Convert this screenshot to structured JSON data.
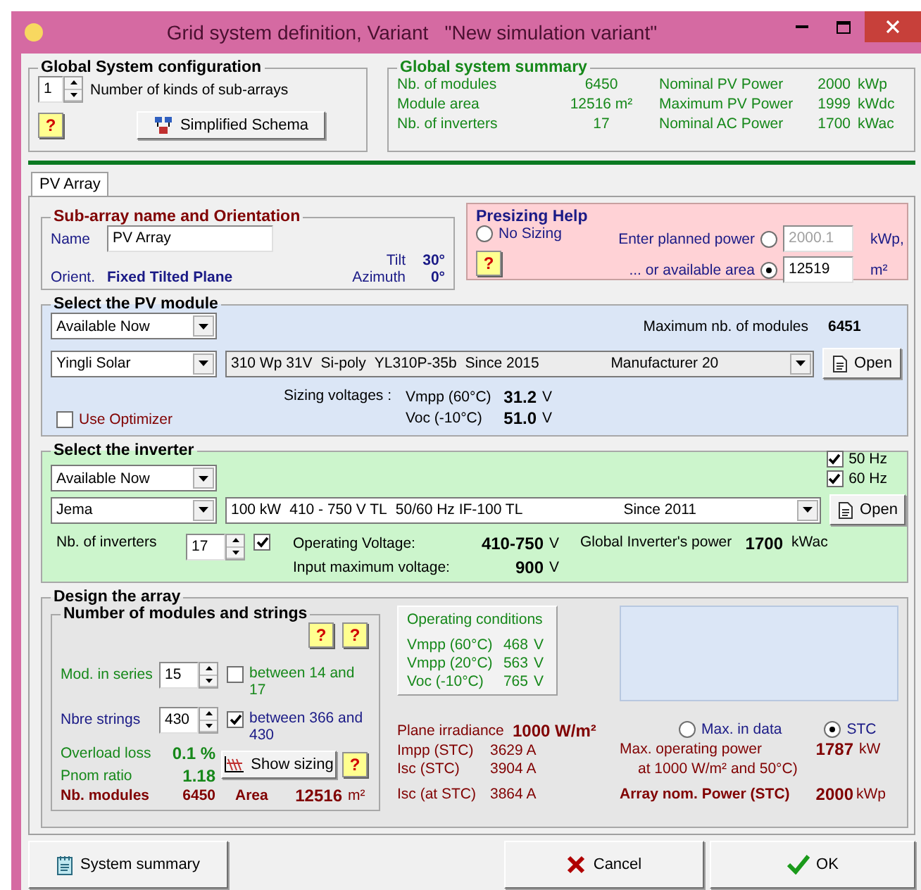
{
  "window": {
    "title": "Grid system definition, Variant   \"New simulation variant\""
  },
  "global_config": {
    "title": "Global System configuration",
    "count": "1",
    "count_label": "Number of kinds of sub-arrays",
    "help": "?",
    "schema_button": "Simplified Schema"
  },
  "summary": {
    "title": "Global system summary",
    "left": [
      {
        "label": "Nb. of modules",
        "value": "6450"
      },
      {
        "label": "Module area",
        "value": "12516 m²"
      },
      {
        "label": "Nb. of inverters",
        "value": "17"
      }
    ],
    "right": [
      {
        "label": "Nominal PV Power",
        "value": "2000",
        "unit": "kWp"
      },
      {
        "label": "Maximum PV Power",
        "value": "1999",
        "unit": "kWdc"
      },
      {
        "label": "Nominal AC Power",
        "value": "1700",
        "unit": "kWac"
      }
    ]
  },
  "tabs": [
    {
      "label": "PV Array",
      "selected": true
    }
  ],
  "subarray": {
    "title": "Sub-array name and Orientation",
    "name_label": "Name",
    "name_value": "PV Array",
    "orient_label": "Orient.",
    "orient_value": "Fixed Tilted Plane",
    "tilt_label": "Tilt",
    "tilt_value": "30°",
    "azimuth_label": "Azimuth",
    "azimuth_value": "0°"
  },
  "presizing": {
    "title": "Presizing Help",
    "help": "?",
    "options": [
      {
        "kind": "none",
        "label": "No Sizing",
        "selected": false
      },
      {
        "kind": "power",
        "label": "Enter planned power",
        "value": "2000.1",
        "unit": "kWp,",
        "selected": false,
        "disabled": true
      },
      {
        "kind": "area",
        "label": "... or available area",
        "value": "12519",
        "unit": "m²",
        "selected": true,
        "disabled": false
      }
    ]
  },
  "module": {
    "title": "Select the PV module",
    "availability": "Available Now",
    "manufacturer": "Yingli Solar",
    "model": [
      "310 Wp 31V",
      "Si-poly",
      "YL310P-35b",
      "Since 2015",
      "Manufacturer 20"
    ],
    "open_button": "Open",
    "max_label": "Maximum nb. of modules",
    "max_value": "6451",
    "sizing_label": "Sizing voltages :",
    "voltages": [
      {
        "label": "Vmpp (60°C)",
        "value": "31.2",
        "unit": "V"
      },
      {
        "label": "Voc  (-10°C)",
        "value": "51.0",
        "unit": "V"
      }
    ],
    "optimizer": {
      "label": "Use Optimizer",
      "checked": false
    }
  },
  "inverter": {
    "title": "Select the inverter",
    "availability": "Available Now",
    "manufacturer": "Jema",
    "model": [
      "100 kW",
      "410 - 750 V  TL",
      "50/60 Hz  IF-100 TL",
      "Since 2011"
    ],
    "frequencies": [
      {
        "label": "50 Hz",
        "checked": true
      },
      {
        "label": "60 Hz",
        "checked": true
      }
    ],
    "open_button": "Open",
    "count_label": "Nb. of inverters",
    "count": "17",
    "count_checked": true,
    "voltages": [
      {
        "label": "Operating Voltage:",
        "value": "410-750",
        "unit": "V"
      },
      {
        "label": "Input maximum voltage:",
        "value": "900",
        "unit": "V"
      }
    ],
    "power_label": "Global Inverter's power",
    "power_value": "1700",
    "power_unit": "kWac"
  },
  "design": {
    "title": "Design the array",
    "strings_title": "Number of modules and strings",
    "helps": [
      "?",
      "?"
    ],
    "series": {
      "label": "Mod. in series",
      "value": "15",
      "check_label": "between 14 and 17",
      "checked": false
    },
    "strings": {
      "label": "Nbre strings",
      "value": "430",
      "check_label": "between 366 and 430",
      "checked": true
    },
    "overload": {
      "label": "Overload loss",
      "value": "0.1 %"
    },
    "pnom": {
      "label": "Pnom ratio",
      "value": "1.18"
    },
    "show_sizing": "Show sizing",
    "sizing_help": "?",
    "nb_modules": {
      "label": "Nb. modules",
      "value": "6450"
    },
    "area": {
      "label": "Area",
      "value": "12516",
      "unit": "m²"
    },
    "conditions": {
      "title": "Operating conditions",
      "rows": [
        {
          "label": "Vmpp (60°C)",
          "value": "468",
          "unit": "V"
        },
        {
          "label": "Vmpp (20°C)",
          "value": "563",
          "unit": "V"
        },
        {
          "label": "Voc  (-10°C)",
          "value": "765",
          "unit": "V"
        }
      ]
    },
    "irradiance": {
      "label": "Plane irradiance",
      "value": "1000 W/m²"
    },
    "currents": [
      {
        "label": "Impp (STC)",
        "value": "3629 A"
      },
      {
        "label": "Isc  (STC)",
        "value": "3904 A"
      }
    ],
    "isc_at": {
      "label": "Isc (at STC)",
      "value": "3864 A"
    },
    "radios": [
      {
        "label": "Max. in data",
        "selected": false
      },
      {
        "label": "STC",
        "selected": true
      }
    ],
    "max_power": {
      "label": "Max. operating power",
      "sublabel": "at 1000 W/m² and 50°C)",
      "value": "1787",
      "unit": "kW"
    },
    "nom_power": {
      "label": "Array nom. Power (STC)",
      "value": "2000",
      "unit": "kWp"
    }
  },
  "buttons": [
    {
      "kind": "summary",
      "label": "System summary"
    },
    {
      "kind": "cancel",
      "label": "Cancel"
    },
    {
      "kind": "ok",
      "label": "OK"
    }
  ]
}
